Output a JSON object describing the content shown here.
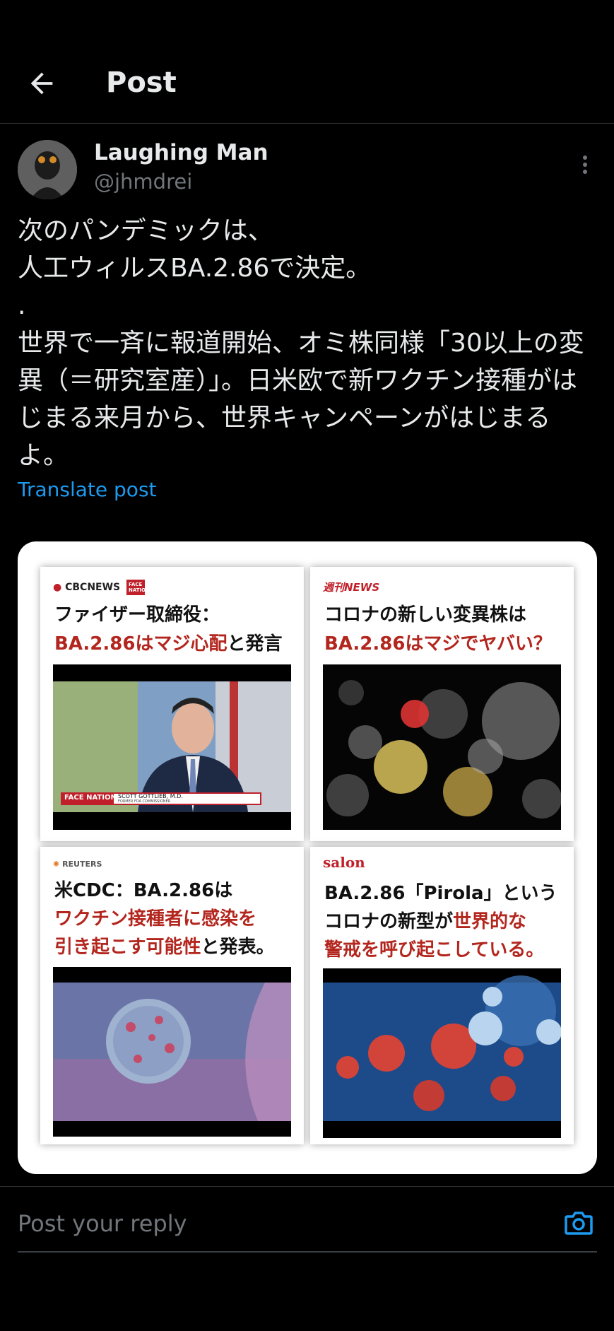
{
  "header": {
    "title": "Post"
  },
  "author": {
    "name": "Laughing Man",
    "handle": "@jhmdrei"
  },
  "post": {
    "text": "次のパンデミックは、\n人工ウィルスBA.2.86で決定。\n.\n世界で一斉に報道開始、オミ株同様「30以上の変異（＝研究室産）」。日米欧で新ワクチン接種がはじまる来月から、世界キャンペーンがはじまるよ。",
    "translate_label": "Translate post"
  },
  "media": {
    "cards": [
      {
        "source": "CBCNEWS",
        "source_badge": "FACE NATION",
        "line1": "ファイザー取締役：",
        "line2_red": "BA.2.86はマジ心配",
        "line2_black": "と発言",
        "caption_brand": "FACE NATION",
        "caption_name": "SCOTT GOTTLIEB, M.D.",
        "caption_role": "FORMER FDA COMMISSIONER"
      },
      {
        "source": "週刊NEWS",
        "line1": "コロナの新しい変異株は",
        "line2_red": "BA.2.86はマジでヤバい？"
      },
      {
        "source": "REUTERS",
        "line1": "米CDC：BA.2.86は",
        "line2_red": "ワクチン接種者に感染を",
        "line3_red": "引き起こす可能性",
        "line3_black": "と発表。"
      },
      {
        "source": "salon",
        "line1": "BA.2.86「Pirola」という",
        "line2_black": "コロナの新型が",
        "line2_red": "世界的な",
        "line3_red": "警戒を呼び起こしている。"
      }
    ]
  },
  "reply": {
    "placeholder": "Post your reply"
  },
  "colors": {
    "accent": "#1d9bf0",
    "headline_red": "#b3261e",
    "background": "#000000"
  }
}
